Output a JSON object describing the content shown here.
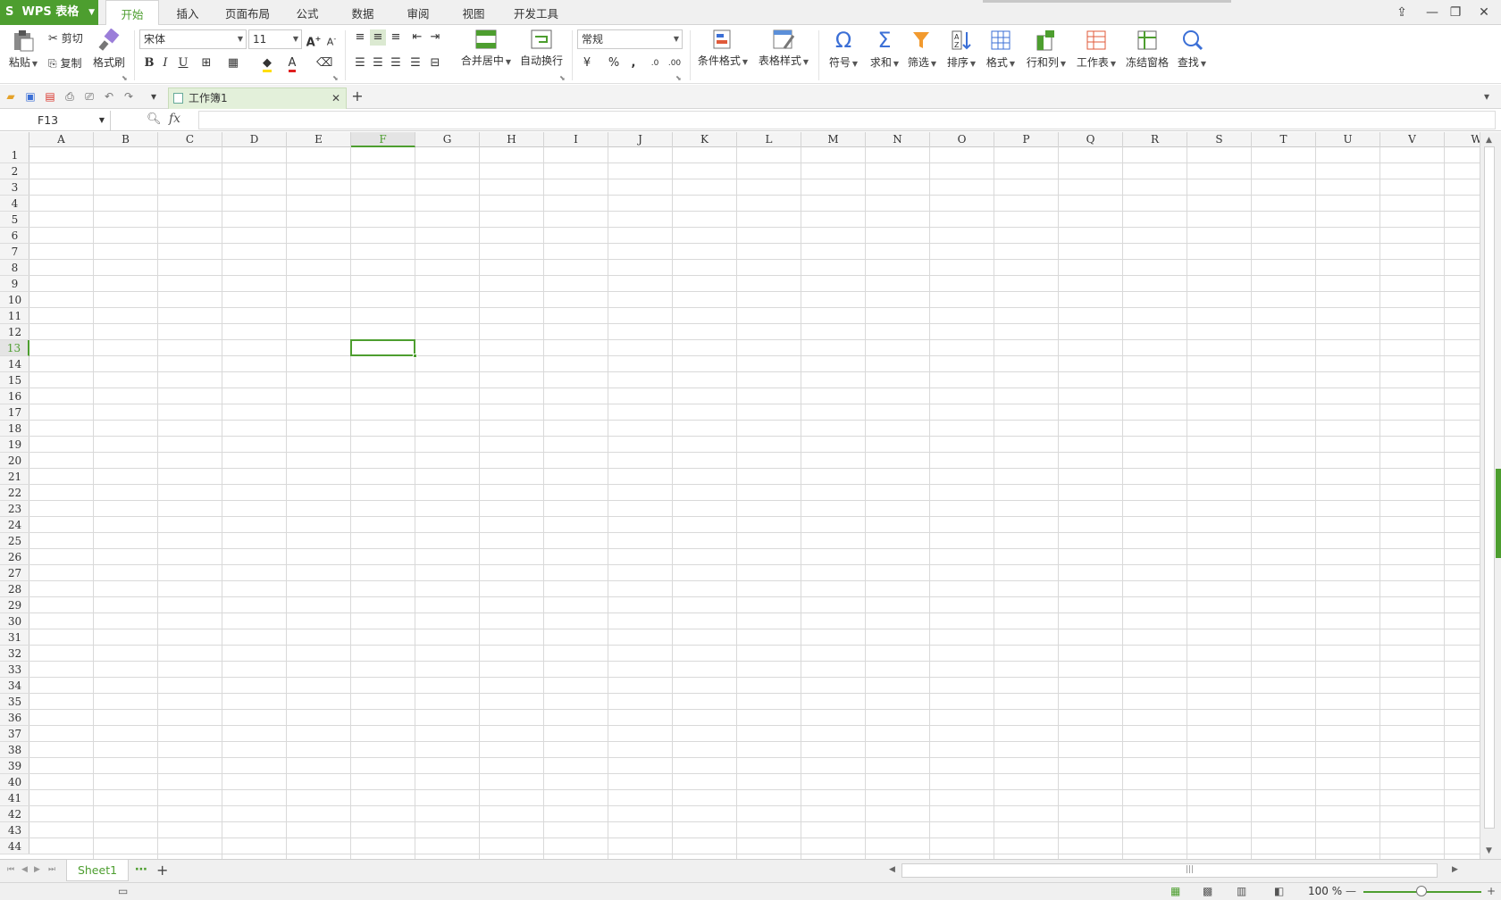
{
  "app": {
    "logo": "WPS 表格"
  },
  "menu_tabs": [
    "开始",
    "插入",
    "页面布局",
    "公式",
    "数据",
    "审阅",
    "视图",
    "开发工具"
  ],
  "ribbon": {
    "paste": "粘贴",
    "cut": "剪切",
    "copy": "复制",
    "format_painter": "格式刷",
    "font_name": "宋体",
    "font_size": "11",
    "bold": "B",
    "italic": "I",
    "underline": "U",
    "merge_center": "合并居中",
    "wrap_text": "自动换行",
    "number_format": "常规",
    "percent": "%",
    "comma": ",",
    "cond_format": "条件格式",
    "table_style": "表格样式",
    "symbol": "符号",
    "sum": "求和",
    "filter": "筛选",
    "sort": "排序",
    "format": "格式",
    "row_col": "行和列",
    "worksheet": "工作表",
    "freeze": "冻结窗格",
    "find": "查找"
  },
  "document": {
    "tab_title": "工作簿1"
  },
  "formula_bar": {
    "name_box": "F13",
    "fx": "fx",
    "formula": ""
  },
  "grid": {
    "columns": [
      "A",
      "B",
      "C",
      "D",
      "E",
      "F",
      "G",
      "H",
      "I",
      "J",
      "K",
      "L",
      "M",
      "N",
      "O",
      "P",
      "Q",
      "R",
      "S",
      "T",
      "U",
      "V",
      "W"
    ],
    "row_count": 44,
    "selected_col": "F",
    "selected_row": 13
  },
  "sheets": {
    "active": "Sheet1"
  },
  "status": {
    "zoom": "100 %"
  },
  "colors": {
    "accent": "#4d9e2f",
    "grid_line": "#d9d9d9"
  }
}
